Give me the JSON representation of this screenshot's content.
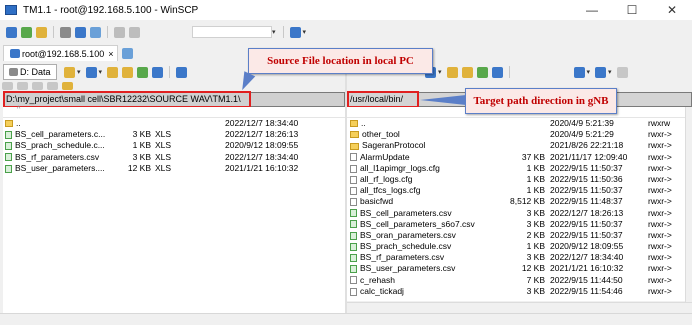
{
  "window": {
    "title": "TM1.1 - root@192.168.5.100 - WinSCP",
    "minimize": "—",
    "maximize": "☐",
    "close": "✕"
  },
  "session": {
    "tab_label": "root@192.168.5.100",
    "tab_close": "×"
  },
  "left_panel": {
    "drive": "D: Data",
    "path": "D:\\my_project\\small cell\\SBR12232\\SOURCE WAV\\TM1.1\\",
    "files": [
      {
        "name": "..",
        "size": "",
        "type": "",
        "changed": "2022/12/7  18:34:40",
        "icon": "up"
      },
      {
        "name": "BS_cell_parameters.c...",
        "size": "3 KB",
        "type": "XLS",
        "changed": "2022/12/7  18:26:13",
        "icon": "csv"
      },
      {
        "name": "BS_prach_schedule.c...",
        "size": "1 KB",
        "type": "XLS",
        "changed": "2020/9/12  18:09:55",
        "icon": "csv"
      },
      {
        "name": "BS_rf_parameters.csv",
        "size": "3 KB",
        "type": "XLS",
        "changed": "2022/12/7  18:34:40",
        "icon": "csv"
      },
      {
        "name": "BS_user_parameters....",
        "size": "12 KB",
        "type": "XLS",
        "changed": "2021/1/21  16:10:32",
        "icon": "csv"
      }
    ]
  },
  "right_panel": {
    "path": "/usr/local/bin/",
    "files": [
      {
        "name": "..",
        "size": "",
        "changed": "2020/4/9 5:21:39",
        "rights": "rwxrw",
        "icon": "up"
      },
      {
        "name": "other_tool",
        "size": "",
        "changed": "2020/4/9 5:21:29",
        "rights": "rwxr->",
        "icon": "folder"
      },
      {
        "name": "SageranProtocol",
        "size": "",
        "changed": "2021/8/26 22:21:18",
        "rights": "rwxr->",
        "icon": "folder"
      },
      {
        "name": "AlarmUpdate",
        "size": "37 KB",
        "changed": "2021/11/17 12:09:40",
        "rights": "rwxr->",
        "icon": "gen"
      },
      {
        "name": "all_l1apimgr_logs.cfg",
        "size": "1 KB",
        "changed": "2022/9/15 11:50:37",
        "rights": "rwxr->",
        "icon": "gen"
      },
      {
        "name": "all_rf_logs.cfg",
        "size": "1 KB",
        "changed": "2022/9/15 11:50:36",
        "rights": "rwxr->",
        "icon": "gen"
      },
      {
        "name": "all_tfcs_logs.cfg",
        "size": "1 KB",
        "changed": "2022/9/15 11:50:37",
        "rights": "rwxr->",
        "icon": "gen"
      },
      {
        "name": "basicfwd",
        "size": "8,512 KB",
        "changed": "2022/9/15 11:48:37",
        "rights": "rwxr->",
        "icon": "gen"
      },
      {
        "name": "BS_cell_parameters.csv",
        "size": "3 KB",
        "changed": "2022/12/7 18:26:13",
        "rights": "rwxr->",
        "icon": "csv"
      },
      {
        "name": "BS_cell_parameters_s6o7.csv",
        "size": "3 KB",
        "changed": "2022/9/15 11:50:37",
        "rights": "rwxr->",
        "icon": "csv"
      },
      {
        "name": "BS_oran_parameters.csv",
        "size": "2 KB",
        "changed": "2022/9/15 11:50:37",
        "rights": "rwxr->",
        "icon": "csv"
      },
      {
        "name": "BS_prach_schedule.csv",
        "size": "1 KB",
        "changed": "2020/9/12 18:09:55",
        "rights": "rwxr->",
        "icon": "csv"
      },
      {
        "name": "BS_rf_parameters.csv",
        "size": "3 KB",
        "changed": "2022/12/7 18:34:40",
        "rights": "rwxr->",
        "icon": "csv"
      },
      {
        "name": "BS_user_parameters.csv",
        "size": "12 KB",
        "changed": "2021/1/21 16:10:32",
        "rights": "rwxr->",
        "icon": "csv"
      },
      {
        "name": "c_rehash",
        "size": "7 KB",
        "changed": "2022/9/15 11:44:50",
        "rights": "rwxr->",
        "icon": "gen"
      },
      {
        "name": "calc_tickadj",
        "size": "3 KB",
        "changed": "2022/9/15 11:54:46",
        "rights": "rwxr->",
        "icon": "gen"
      }
    ]
  },
  "callouts": {
    "source": "Source File location in local PC",
    "target": "Target path direction in gNB"
  },
  "colors": {
    "callout_text": "#c00000",
    "highlight_box": "#e02020",
    "callout_border": "#5b7fc8"
  }
}
